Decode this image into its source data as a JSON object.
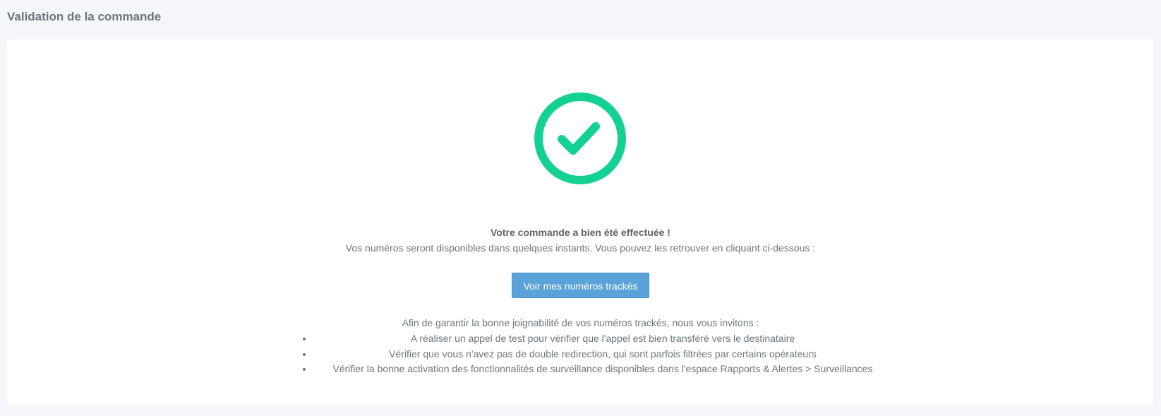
{
  "header": {
    "title": "Validation de la commande"
  },
  "success": {
    "icon": "check-circle-icon",
    "color": "#12d193",
    "title": "Votre commande a bien été effectuée !",
    "body": "Vos numéros seront disponibles dans quelques instants. Vous pouvez les retrouver en cliquant ci-dessous :"
  },
  "button": {
    "label": "Voir mes numéros trackés",
    "color": "#5aa2d8"
  },
  "advice": {
    "intro": "Afin de garantir la bonne joignabilité de vos numéros trackés, nous vous invitons :",
    "items": [
      "A réaliser un appel de test pour vérifier que l'appel est bien transféré vers le destinataire",
      "Vérifier que vous n'avez pas de double redirection, qui sont parfois filtrées par certains opérateurs",
      "Vérifier la bonne activation des fonctionnalités de surveillance disponibles dans l'espace Rapports & Alertes > Surveillances"
    ]
  }
}
